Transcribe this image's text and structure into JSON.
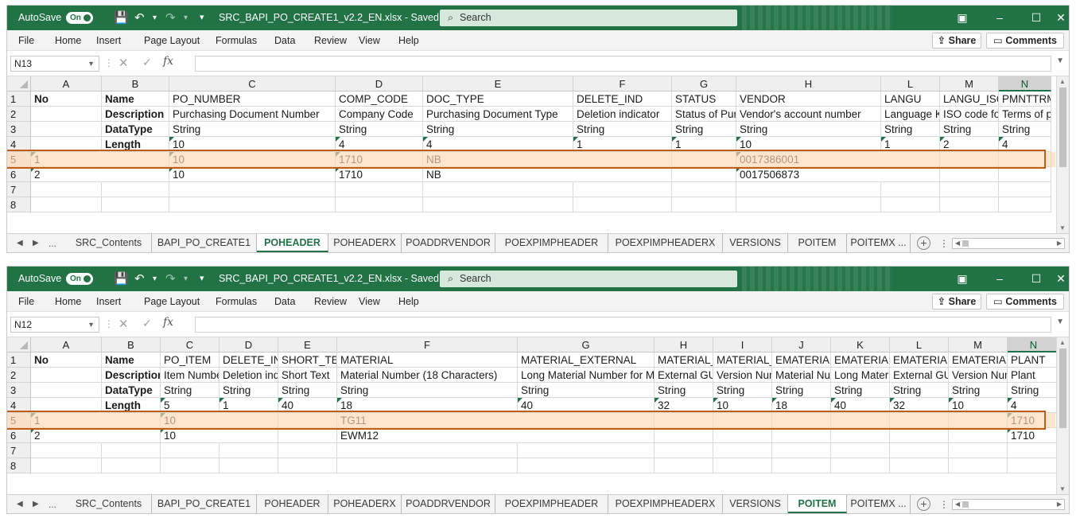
{
  "windows": [
    {
      "id": "win1",
      "autosave_label": "AutoSave",
      "autosave_state": "On",
      "title": "SRC_BAPI_PO_CREATE1_v2.2_EN.xlsx - Saved",
      "search_placeholder": "Search",
      "menu": [
        "File",
        "Home",
        "Insert",
        "Page Layout",
        "Formulas",
        "Data",
        "Review",
        "View",
        "Help"
      ],
      "share_label": "Share",
      "comments_label": "Comments",
      "name_box": "N13",
      "selected_column": "N",
      "columns": [
        {
          "letter": "A",
          "width": 89
        },
        {
          "letter": "B",
          "width": 85
        },
        {
          "letter": "C",
          "width": 209
        },
        {
          "letter": "D",
          "width": 110
        },
        {
          "letter": "E",
          "width": 189
        },
        {
          "letter": "F",
          "width": 124
        },
        {
          "letter": "G",
          "width": 81
        },
        {
          "letter": "H",
          "width": 182
        },
        {
          "letter": "L",
          "width": 74
        },
        {
          "letter": "M",
          "width": 74
        },
        {
          "letter": "N",
          "width": 66
        }
      ],
      "rows": [
        [
          "No",
          "Name",
          "PO_NUMBER",
          "COMP_CODE",
          "DOC_TYPE",
          "DELETE_IND",
          "STATUS",
          "VENDOR",
          "LANGU",
          "LANGU_ISO",
          "PMNTTRM"
        ],
        [
          "",
          "Description",
          "Purchasing Document Number",
          "Company Code",
          "Purchasing Document Type",
          "Deletion indicator",
          "Status of Purchasing Document",
          "Vendor's account number",
          "Language Key",
          "ISO code for language key",
          "Terms of payment key"
        ],
        [
          "",
          "DataType",
          "String",
          "String",
          "String",
          "String",
          "String",
          "String",
          "String",
          "String",
          "String"
        ],
        [
          "",
          "Length",
          "10",
          "4",
          "4",
          "1",
          "1",
          "10",
          "1",
          "2",
          "4"
        ],
        [
          "1",
          "",
          "10",
          "1710",
          "NB",
          "",
          "",
          "0017386001",
          "",
          "",
          ""
        ],
        [
          "2",
          "",
          "10",
          "1710",
          "NB",
          "",
          "",
          "0017506873",
          "",
          "",
          ""
        ],
        [
          "",
          "",
          "",
          "",
          "",
          "",
          "",
          "",
          "",
          "",
          ""
        ],
        [
          "",
          "",
          "",
          "",
          "",
          "",
          "",
          "",
          "",
          "",
          ""
        ]
      ],
      "sheet_tabs": [
        "SRC_Contents",
        "BAPI_PO_CREATE1",
        "POHEADER",
        "POHEADERX",
        "POADDRVENDOR",
        "POEXPIMPHEADER",
        "POEXPIMPHEADERX",
        "VERSIONS",
        "POITEM",
        "POITEMX ..."
      ],
      "active_tab": "POHEADER"
    },
    {
      "id": "win2",
      "autosave_label": "AutoSave",
      "autosave_state": "On",
      "title": "SRC_BAPI_PO_CREATE1_v2.2_EN.xlsx - Saved",
      "search_placeholder": "Search",
      "menu": [
        "File",
        "Home",
        "Insert",
        "Page Layout",
        "Formulas",
        "Data",
        "Review",
        "View",
        "Help"
      ],
      "share_label": "Share",
      "comments_label": "Comments",
      "name_box": "N12",
      "selected_column": "N",
      "columns": [
        {
          "letter": "A",
          "width": 89
        },
        {
          "letter": "B",
          "width": 74
        },
        {
          "letter": "C",
          "width": 74
        },
        {
          "letter": "D",
          "width": 74
        },
        {
          "letter": "E",
          "width": 74
        },
        {
          "letter": "F",
          "width": 227
        },
        {
          "letter": "G",
          "width": 172
        },
        {
          "letter": "H",
          "width": 74
        },
        {
          "letter": "I",
          "width": 74
        },
        {
          "letter": "J",
          "width": 74
        },
        {
          "letter": "K",
          "width": 74
        },
        {
          "letter": "L",
          "width": 74
        },
        {
          "letter": "M",
          "width": 74
        },
        {
          "letter": "N",
          "width": 66
        }
      ],
      "rows": [
        [
          "No",
          "Name",
          "PO_ITEM",
          "DELETE_IND",
          "SHORT_TEXT",
          "MATERIAL",
          "MATERIAL_EXTERNAL",
          "MATERIAL_GUID",
          "MATERIAL_VERSION",
          "EMATERIAL",
          "EMATERIAL_LONG",
          "EMATERIAL_GUID",
          "EMATERIAL_VERSION",
          "PLANT"
        ],
        [
          "",
          "Description",
          "Item Number",
          "Deletion indicator",
          "Short Text",
          "Material Number (18 Characters)",
          "Long Material Number for MATERIAL",
          "External GUID",
          "Version Number",
          "Material Number",
          "Long Material Number",
          "External GUID",
          "Version Number",
          "Plant"
        ],
        [
          "",
          "DataType",
          "String",
          "String",
          "String",
          "String",
          "String",
          "String",
          "String",
          "String",
          "String",
          "String",
          "String",
          "String"
        ],
        [
          "",
          "Length",
          "5",
          "1",
          "40",
          "18",
          "40",
          "32",
          "10",
          "18",
          "40",
          "32",
          "10",
          "4"
        ],
        [
          "1",
          "",
          "10",
          "",
          "",
          "TG11",
          "",
          "",
          "",
          "",
          "",
          "",
          "",
          "1710"
        ],
        [
          "2",
          "",
          "10",
          "",
          "",
          "EWM12",
          "",
          "",
          "",
          "",
          "",
          "",
          "",
          "1710"
        ],
        [
          "",
          "",
          "",
          "",
          "",
          "",
          "",
          "",
          "",
          "",
          "",
          "",
          "",
          ""
        ],
        [
          "",
          "",
          "",
          "",
          "",
          "",
          "",
          "",
          "",
          "",
          "",
          "",
          "",
          ""
        ]
      ],
      "sheet_tabs": [
        "SRC_Contents",
        "BAPI_PO_CREATE1",
        "POHEADER",
        "POHEADERX",
        "POADDRVENDOR",
        "POEXPIMPHEADER",
        "POEXPIMPHEADERX",
        "VERSIONS",
        "POITEM",
        "POITEMX ..."
      ],
      "active_tab": "POITEM"
    }
  ],
  "icons": {
    "save": "💾",
    "undo": "↶",
    "redo": "↷",
    "customize": "▾",
    "search": "⌕",
    "ribbon_display": "▣",
    "minimize": "–",
    "maximize": "☐",
    "close": "✕",
    "share": "⇪",
    "comments": "▭",
    "nav_left": "◀",
    "nav_right": "▶",
    "ellipsis": "...",
    "add": "+"
  },
  "colors": {
    "excel_green": "#217346",
    "highlight_fill": "#FCD7B4",
    "highlight_border": "#C55A11"
  }
}
